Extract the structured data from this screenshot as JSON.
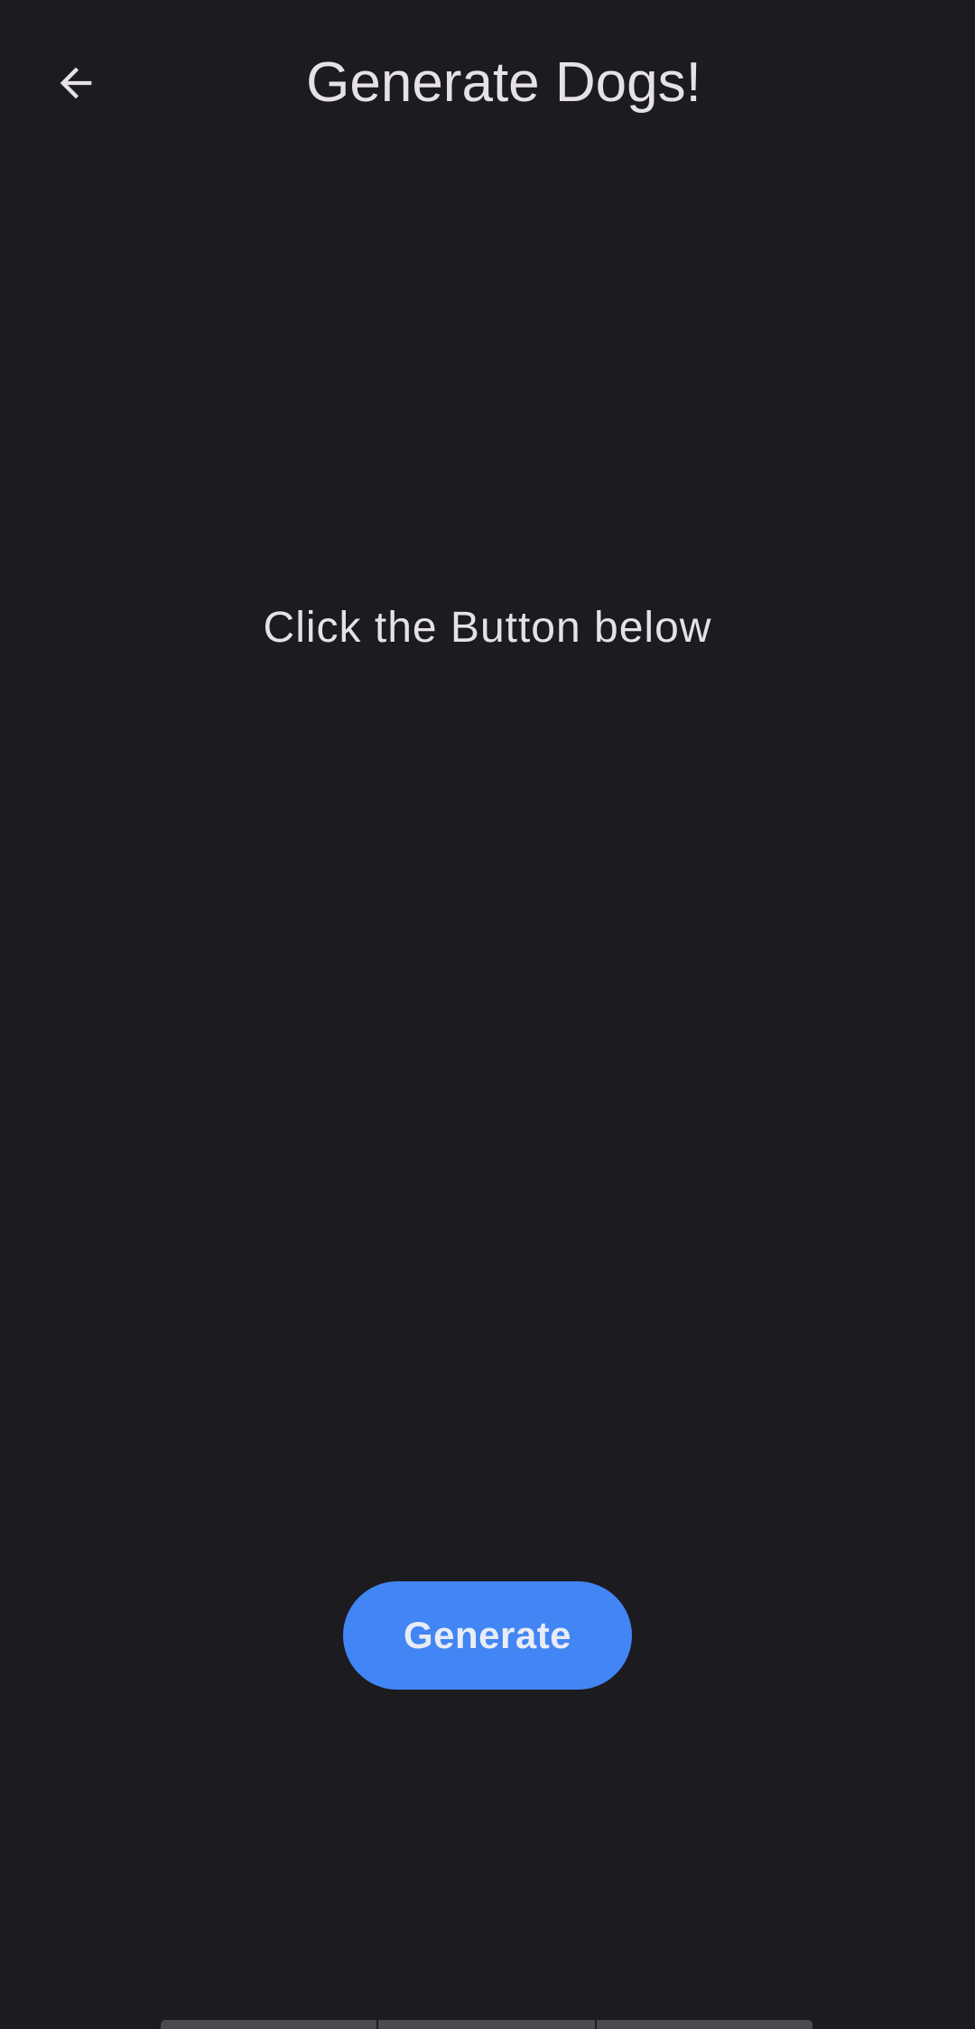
{
  "header": {
    "title": "Generate Dogs!",
    "back_icon": "arrow-back-icon"
  },
  "main": {
    "hint": "Click the Button below"
  },
  "actions": {
    "generate_label": "Generate"
  },
  "colors": {
    "background": "#1c1b20",
    "text": "#e6e1e8",
    "accent": "#4285f4"
  }
}
